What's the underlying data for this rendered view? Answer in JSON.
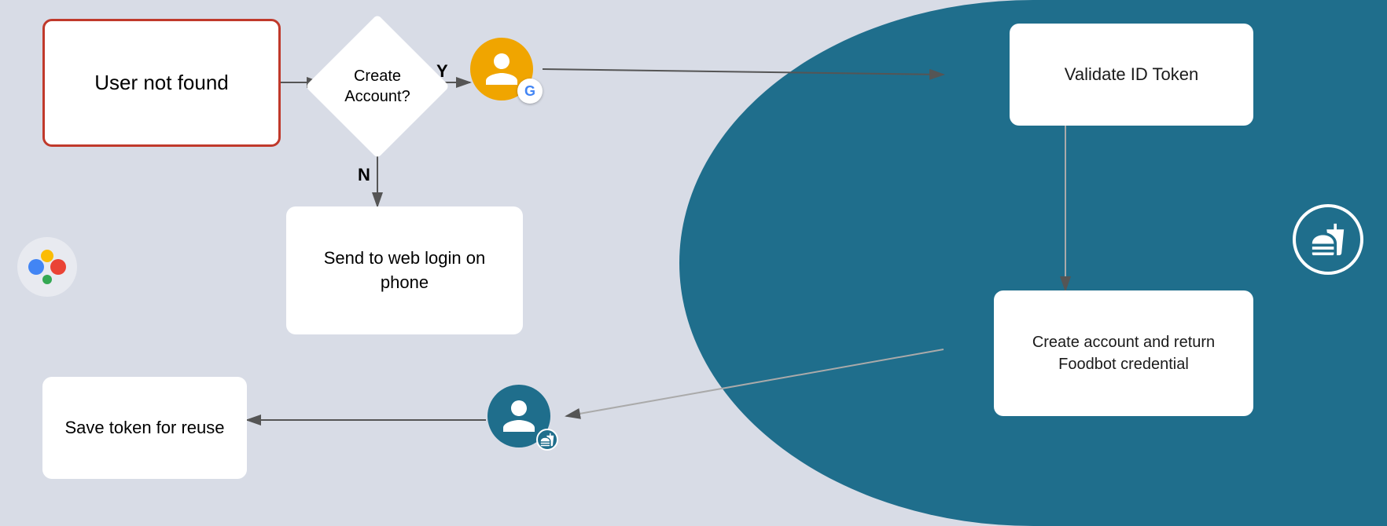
{
  "boxes": {
    "user_not_found": "User not found",
    "create_account_question": "Create\nAccount?",
    "send_to_web": "Send to web login on phone",
    "validate_token": "Validate ID Token",
    "create_account_return": "Create account and return Foodbot credential",
    "save_token": "Save token for reuse"
  },
  "labels": {
    "yes": "Y",
    "no": "N"
  },
  "icons": {
    "google_g": "G",
    "fork_knife": "🍴",
    "assistant_dots": "assistant"
  },
  "colors": {
    "bg_left": "#d8dce6",
    "bg_right": "#1f6e8c",
    "box_border_red": "#c0392b",
    "white": "#ffffff",
    "orange": "#f0a500",
    "teal": "#1f6e8c"
  }
}
